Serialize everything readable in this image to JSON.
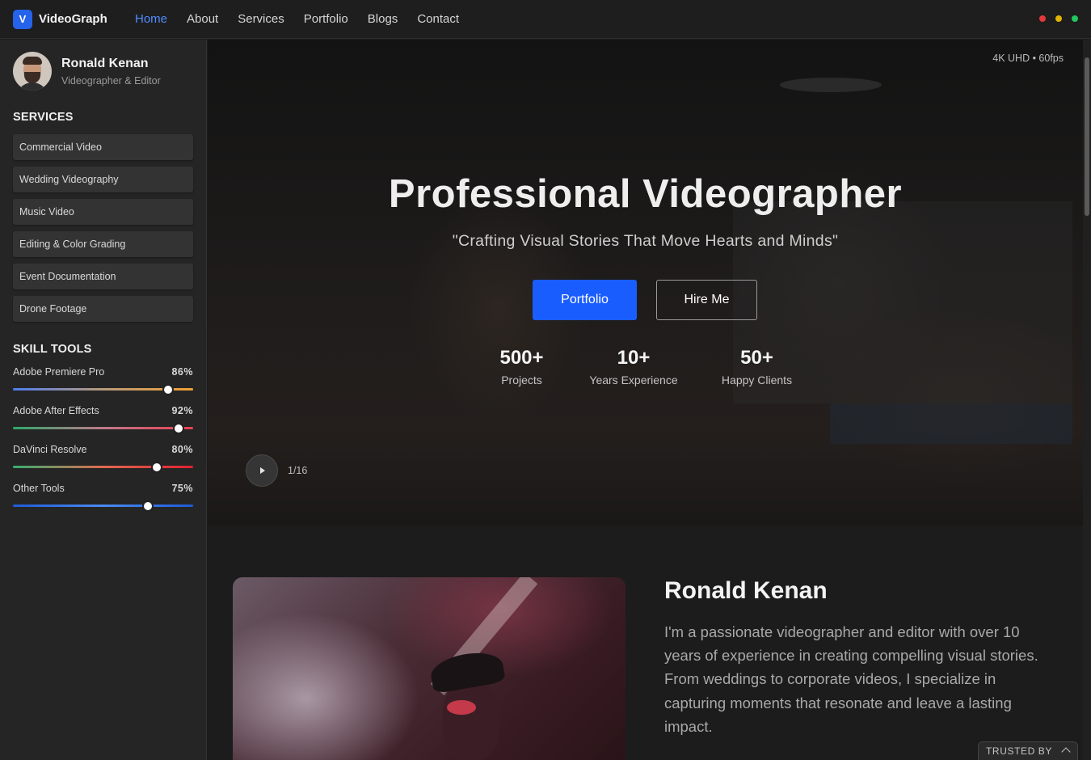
{
  "brand": {
    "logo_letter": "V",
    "name": "VideoGraph",
    "accent": "#2563eb"
  },
  "nav": {
    "items": [
      "Home",
      "About",
      "Services",
      "Portfolio",
      "Blogs",
      "Contact"
    ],
    "active": "Home"
  },
  "window_dots": [
    "#e5383b",
    "#e0b400",
    "#22c55e"
  ],
  "profile": {
    "name": "Ronald Kenan",
    "role": "Videographer & Editor"
  },
  "services": {
    "title": "SERVICES",
    "items": [
      "Commercial Video",
      "Wedding Videography",
      "Music Video",
      "Editing & Color Grading",
      "Event Documentation",
      "Drone Footage"
    ]
  },
  "skills": {
    "title": "SKILL TOOLS",
    "items": [
      {
        "name": "Adobe Premiere Pro",
        "percent_label": "86%",
        "value": 86,
        "gradient": "linear-gradient(90deg,#4f7cf0,#b99a7a,#f0a030)"
      },
      {
        "name": "Adobe After Effects",
        "percent_label": "92%",
        "value": 92,
        "gradient": "linear-gradient(90deg,#2ea86a,#c07a8a,#e84050)"
      },
      {
        "name": "DaVinci Resolve",
        "percent_label": "80%",
        "value": 80,
        "gradient": "linear-gradient(90deg,#35b070,#e06a50,#e02030)"
      },
      {
        "name": "Other Tools",
        "percent_label": "75%",
        "value": 75,
        "gradient": "linear-gradient(90deg,#1e5bd8,#4a8af0,#1e5bd8)"
      }
    ]
  },
  "hero": {
    "badge": "4K UHD • 60fps",
    "title": "Professional Videographer",
    "subtitle": "\"Crafting Visual Stories That Move Hearts and Minds\"",
    "primary_button": "Portfolio",
    "secondary_button": "Hire Me",
    "stats": [
      {
        "value": "500+",
        "label": "Projects"
      },
      {
        "value": "10+",
        "label": "Years Experience"
      },
      {
        "value": "50+",
        "label": "Happy Clients"
      }
    ],
    "slide_counter": "1/16"
  },
  "about": {
    "name": "Ronald Kenan",
    "text": "I'm a passionate videographer and editor with over 10 years of experience in creating compelling visual stories. From weddings to corporate videos, I specialize in capturing moments that resonate and leave a lasting impact."
  },
  "trusted": {
    "label": "TRUSTED BY"
  }
}
